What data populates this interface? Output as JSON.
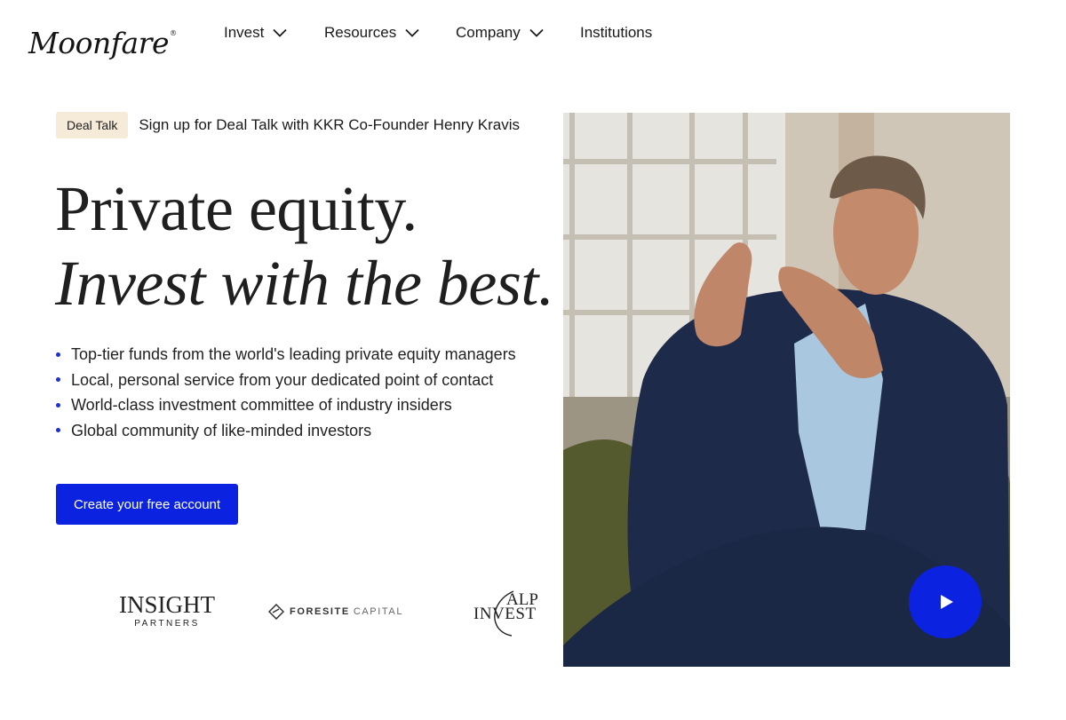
{
  "header": {
    "logo_text": "Moonfare",
    "logo_mark": "®",
    "nav": [
      {
        "label": "Invest",
        "has_dropdown": true
      },
      {
        "label": "Resources",
        "has_dropdown": true
      },
      {
        "label": "Company",
        "has_dropdown": true
      },
      {
        "label": "Institutions",
        "has_dropdown": false
      }
    ]
  },
  "announcement": {
    "badge": "Deal Talk",
    "text": "Sign up for Deal Talk with KKR Co-Founder Henry Kravis"
  },
  "hero": {
    "headline_line1": "Private equity.",
    "headline_line2": "Invest with the best.",
    "bullets": [
      "Top-tier funds from the world's leading private equity managers",
      "Local, personal service from your dedicated point of contact",
      "World-class investment committee of industry insiders",
      "Global community of like-minded investors"
    ],
    "cta_label": "Create your free account"
  },
  "partner_logos": {
    "insight": {
      "main": "INSIGHT",
      "sub": "PARTNERS"
    },
    "foresite": {
      "bold": "FORESITE",
      "light": "CAPITAL"
    },
    "alpinvest": {
      "top": "ALP",
      "bottom": "INVEST"
    }
  },
  "video": {
    "play_icon": "play-icon"
  },
  "colors": {
    "accent": "#0b23e0",
    "badge_bg": "#f6ead8",
    "text": "#1a1a1a"
  }
}
